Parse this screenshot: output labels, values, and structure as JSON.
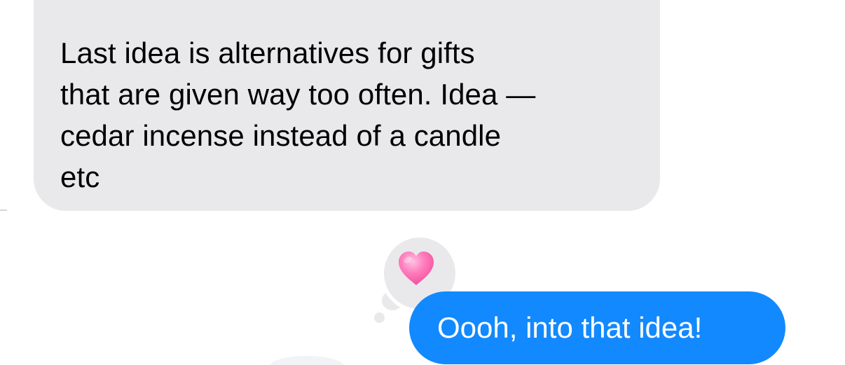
{
  "conversation": {
    "incoming_message": {
      "text": "Last idea is alternatives for gifts\nthat are given way too often. Idea —\ncedar incense instead of a candle\netc",
      "bubble_color": "#e9e9eb",
      "text_color": "#000000"
    },
    "outgoing_message": {
      "text": "Oooh, into that idea!",
      "bubble_color": "#1289fe",
      "text_color": "#ffffff",
      "reaction": {
        "icon": "heart-icon",
        "color": "#ff6fb0"
      }
    }
  }
}
